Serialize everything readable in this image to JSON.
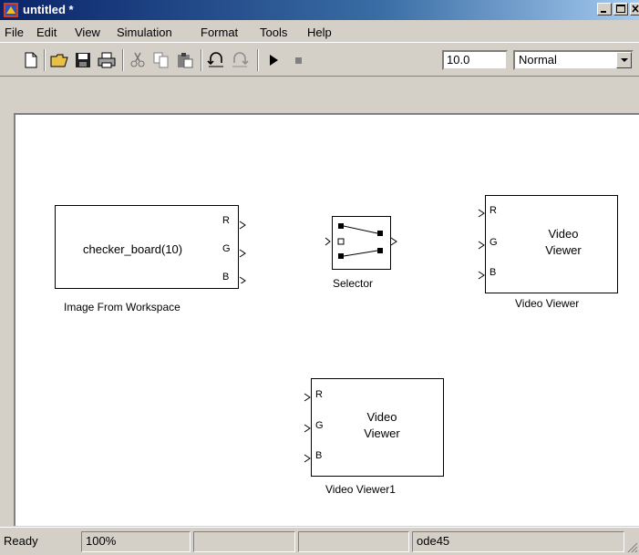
{
  "window": {
    "title": "untitled *",
    "min_glyph": "_",
    "max_glyph": "□",
    "close_glyph": "×"
  },
  "menu": [
    "File",
    "Edit",
    "View",
    "Simulation",
    "Format",
    "Tools",
    "Help"
  ],
  "toolbar": {
    "stop_time": "10.0",
    "sim_mode": "Normal"
  },
  "blocks": {
    "image_from_workspace": {
      "name": "Image From Workspace",
      "expr": "checker_board(10)",
      "ports": [
        "R",
        "G",
        "B"
      ]
    },
    "selector": {
      "name": "Selector"
    },
    "video_viewer": {
      "name": "Video Viewer",
      "line1": "Video",
      "line2": "Viewer",
      "ports": [
        "R",
        "G",
        "B"
      ]
    },
    "video_viewer1": {
      "name": "Video Viewer1",
      "line1": "Video",
      "line2": "Viewer",
      "ports": [
        "R",
        "G",
        "B"
      ]
    }
  },
  "status": {
    "state": "Ready",
    "zoom": "100%",
    "solver": "ode45"
  },
  "colors": {
    "title_start": "#0a246a",
    "title_end": "#a6caf0",
    "chrome": "#d4d0c8"
  },
  "icons": [
    "new-icon",
    "open-icon",
    "save-icon",
    "print-icon",
    "cut-icon",
    "copy-icon",
    "paste-icon",
    "undo-icon",
    "redo-icon",
    "play-icon",
    "stop-icon"
  ]
}
